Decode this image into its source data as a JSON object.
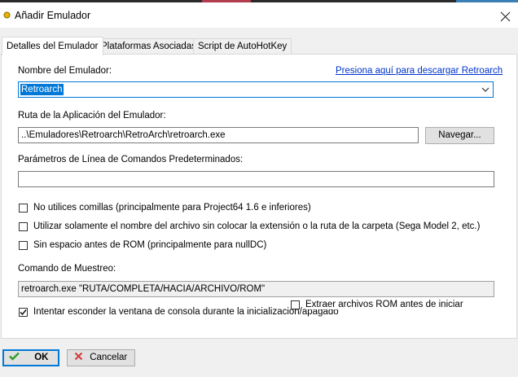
{
  "window": {
    "title": "Añadir Emulador",
    "close_glyph": "✕"
  },
  "tabs": [
    {
      "label": "Detalles del Emulador",
      "active": true
    },
    {
      "label": "Plataformas Asociadas",
      "active": false
    },
    {
      "label": "Script de AutoHotKey",
      "active": false
    }
  ],
  "form": {
    "name_label": "Nombre del Emulador:",
    "download_link": "Presiona aquí para descargar Retroarch",
    "name_value": "Retroarch",
    "path_label": "Ruta de la Aplicación del Emulador:",
    "path_value": "..\\Emuladores\\Retroarch\\RetroArch\\retroarch.exe",
    "browse_label": "Navegar...",
    "params_label": "Parámetros de Línea de Comandos Predeterminados:",
    "params_value": "",
    "checkboxes": [
      {
        "label": "No utilices comillas (principalmente para Project64 1.6 e inferiores)",
        "checked": false
      },
      {
        "label": "Utilizar solamente el nombre del archivo sin colocar la extensión o la ruta de la carpeta  (Sega Model 2, etc.)",
        "checked": false
      },
      {
        "label": "Sin espacio antes de ROM (principalmente para nullDC)",
        "checked": false
      }
    ],
    "sample_label": "Comando de Muestreo:",
    "sample_value": "retroarch.exe \"RUTA/COMPLETA/HACIA/ARCHIVO/ROM\"",
    "hide_console": {
      "label": "Intentar esconder la ventana de consola durante la inicialización/apagado",
      "checked": true
    },
    "extract_roms": {
      "label": "Extraer archivos ROM antes de iniciar",
      "checked": false
    }
  },
  "footer": {
    "ok_label": "OK",
    "cancel_label": "Cancelar"
  },
  "colors": {
    "accent": "#0078d7",
    "link": "#0033cc",
    "ok_check": "#2e9e2e",
    "cancel_x": "#d23c3c"
  }
}
